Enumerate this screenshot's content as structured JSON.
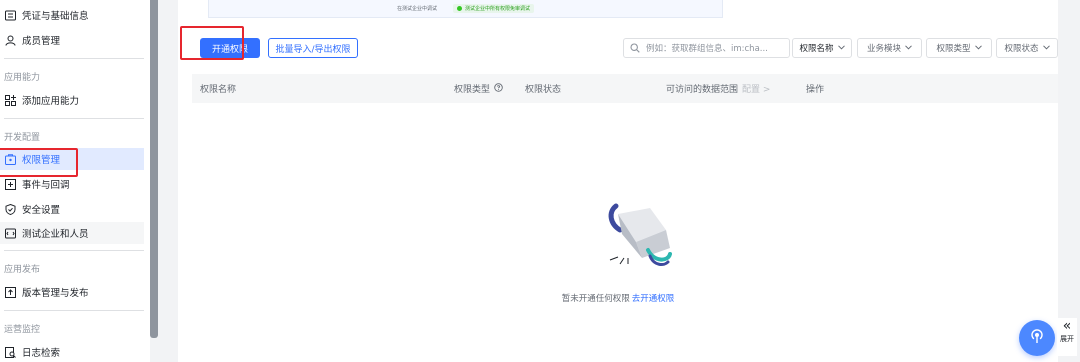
{
  "sidebar": {
    "items_top": [
      {
        "label": "凭证与基础信息",
        "icon": "credential-icon"
      },
      {
        "label": "成员管理",
        "icon": "user-icon"
      }
    ],
    "section_app_ability": "应用能力",
    "add_ability": {
      "label": "添加应用能力",
      "icon": "grid-plus-icon"
    },
    "section_dev_config": "开发配置",
    "dev_items": [
      {
        "label": "权限管理",
        "icon": "permission-icon",
        "active": true
      },
      {
        "label": "事件与回调",
        "icon": "event-icon"
      },
      {
        "label": "安全设置",
        "icon": "shield-icon"
      },
      {
        "label": "测试企业和人员",
        "icon": "test-icon"
      }
    ],
    "section_publish": "应用发布",
    "publish_item": {
      "label": "版本管理与发布",
      "icon": "upload-icon"
    },
    "section_ops": "运营监控",
    "ops_item": {
      "label": "日志检索",
      "icon": "log-search-icon"
    }
  },
  "banner": {
    "text": "在测试企业中调试",
    "chip": "测试企业中所有权限免审调试"
  },
  "toolbar": {
    "primary_button": "开通权限",
    "secondary_button": "批量导入/导出权限",
    "search_placeholder": "例如：获取群组信息、im:cha...",
    "filters": [
      {
        "label": "权限名称"
      },
      {
        "label": "业务模块"
      },
      {
        "label": "权限类型"
      },
      {
        "label": "权限状态"
      }
    ]
  },
  "table": {
    "columns": {
      "name": "权限名称",
      "type": "权限类型",
      "status": "权限状态",
      "scope": "可访问的数据范围",
      "scope_config": "配置 >",
      "action": "操作"
    }
  },
  "empty": {
    "text": "暂未开通任何权限",
    "link": "去开通权限"
  },
  "floating": {
    "expand_label": "展开"
  },
  "colors": {
    "primary": "#3370ff",
    "highlight_box": "#e6262e",
    "active_bg": "#e1eaff"
  }
}
